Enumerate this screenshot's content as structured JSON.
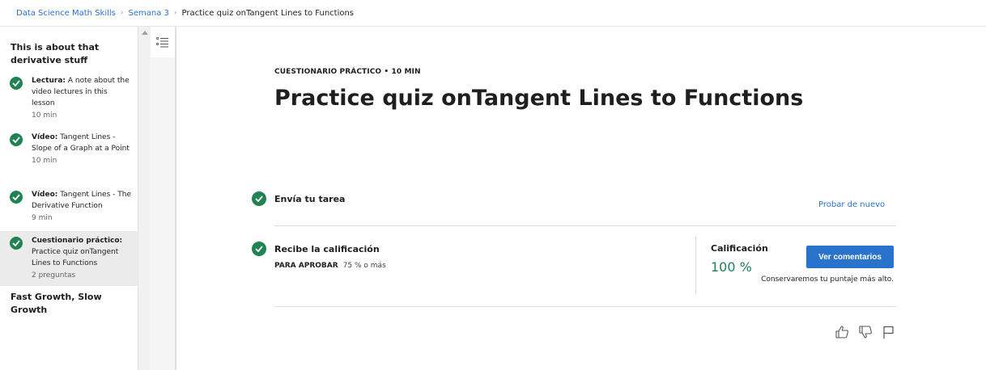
{
  "breadcrumb": {
    "course": "Data Science Math Skills",
    "week": "Semana 3",
    "current": "Practice quiz onTangent Lines to Functions"
  },
  "sidebar": {
    "section1_title": "This is about that derivative stuff",
    "items": [
      {
        "type": "Lectura:",
        "title": " A note about the video lectures in this lesson",
        "meta": "10 min",
        "completed": true,
        "active": false
      },
      {
        "type": "Vídeo:",
        "title": " Tangent Lines - Slope of a Graph at a Point",
        "meta": "10 min",
        "completed": true,
        "active": false
      },
      {
        "type": "Vídeo:",
        "title": " Tangent Lines - The Derivative Function",
        "meta": "9 min",
        "completed": true,
        "active": false
      },
      {
        "type": "Cuestionario práctico:",
        "title": " Practice quiz onTangent Lines to Functions",
        "meta": "2 preguntas",
        "completed": true,
        "active": true
      }
    ],
    "section2_title": "Fast Growth, Slow Growth"
  },
  "main": {
    "kicker": "CUESTIONARIO PRÁCTICO • 10 MIN",
    "title": "Practice quiz onTangent Lines to Functions",
    "step1_label": "Envía tu tarea",
    "retry_label": "Probar de nuevo",
    "step2_label": "Recibe la calificación",
    "pass_label": "PARA APROBAR",
    "pass_value": "75 % o más",
    "grade_label": "Calificación",
    "grade_value": "100 %",
    "feedback_button": "Ver comentarios",
    "keep_note": "Conservaremos tu puntaje más alto."
  },
  "icons": {
    "check": "check-circle-icon",
    "outline": "list-outline-icon",
    "like": "thumbs-up-icon",
    "dislike": "thumbs-down-icon",
    "flag": "flag-icon"
  },
  "colors": {
    "accent": "#2a73cc",
    "success": "#1f8354"
  }
}
